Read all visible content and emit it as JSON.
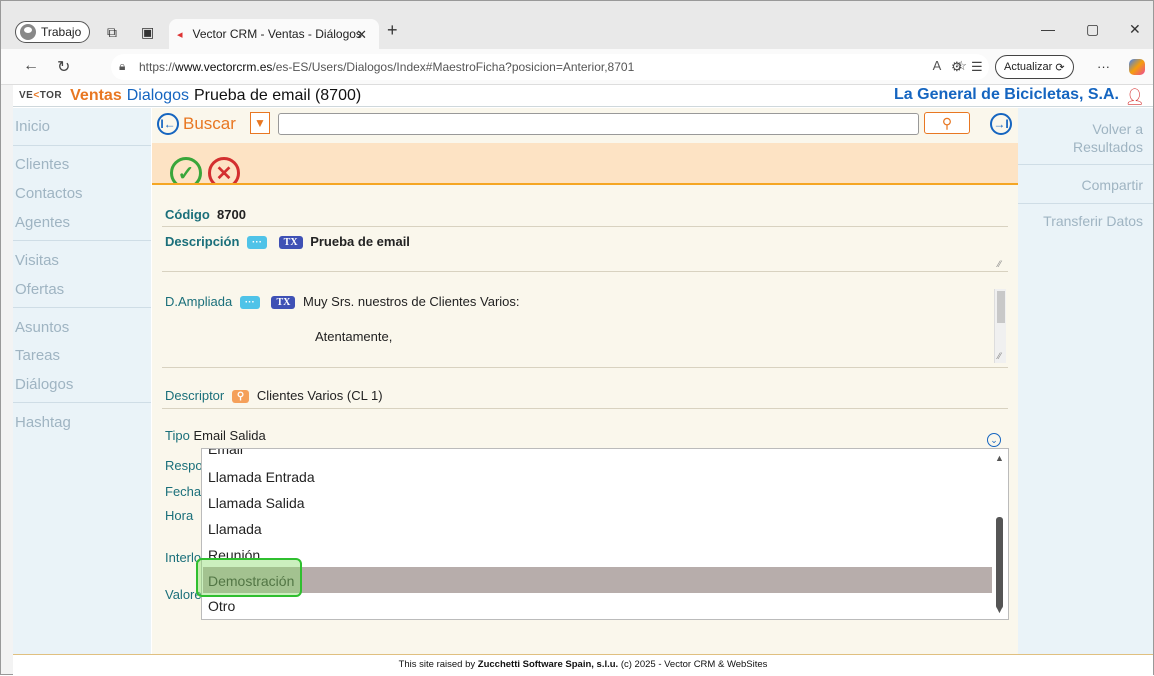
{
  "browser": {
    "profile_label": "Trabajo",
    "tab_title": "Vector CRM - Ventas - Diálogos",
    "url_prefix": "https://",
    "url_host": "www.vectorcrm.es",
    "url_path": "/es-ES/Users/Dialogos/Index#MaestroFicha?posicion=Anterior,8701",
    "update_label": "Actualizar"
  },
  "crm": {
    "module": "Ventas",
    "submodule": "Dialogos",
    "record_title": "Prueba de email (8700)",
    "company": "La General de Bicicletas, S.A."
  },
  "sidebar": {
    "items": [
      "Inicio",
      "Clientes",
      "Contactos",
      "Agentes",
      "Visitas",
      "Ofertas",
      "Asuntos",
      "Tareas",
      "Diálogos",
      "Hashtag"
    ]
  },
  "rightbar": {
    "volver_1": "Volver a",
    "volver_2": "Resultados",
    "compartir": "Compartir",
    "transferir": "Transferir Datos"
  },
  "search": {
    "label": "Buscar",
    "value": ""
  },
  "form": {
    "codigo_label": "Código",
    "codigo_value": "8700",
    "descripcion_label": "Descripción",
    "descripcion_value": "Prueba de email",
    "ampliada_label": "D.Ampliada",
    "ampliada_line1": "Muy Srs. nuestros de Clientes Varios:",
    "ampliada_line2": "Atentamente,",
    "descriptor_label": "Descriptor",
    "descriptor_value": "Clientes Varios (CL 1)",
    "tipo_label": "Tipo",
    "tipo_value": "Email Salida",
    "resp_label": "Respo",
    "fecha_label": "Fecha",
    "hora_label": "Hora",
    "interl_label": "Interlo",
    "valor_label": "Valore",
    "pill_dots": "···",
    "pill_tx": "TX"
  },
  "dropdown": {
    "options": [
      "Email",
      "Llamada Entrada",
      "Llamada Salida",
      "Llamada",
      "Reunión",
      "Demostración",
      "Otro"
    ],
    "selected": "Demostración"
  },
  "footer": {
    "prefix": "This site raised by ",
    "company": "Zucchetti Software Spain, s.l.u.",
    "suffix": " (c) 2025 - Vector CRM & WebSites"
  }
}
